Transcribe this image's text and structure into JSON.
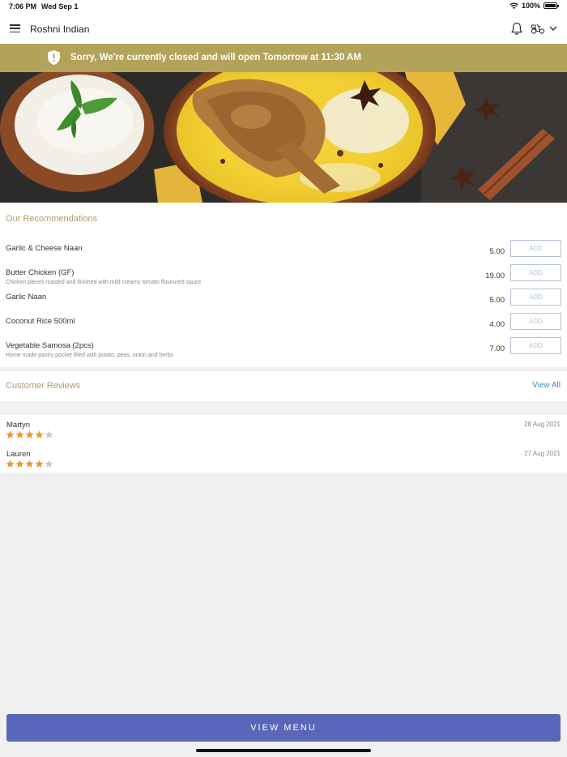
{
  "status_bar": {
    "time": "7:06 PM",
    "date": "Wed Sep 1",
    "battery": "100%"
  },
  "header": {
    "restaurant_name": "Roshni Indian"
  },
  "banner": {
    "message": "Sorry, We're currently closed and will open Tomorrow at 11:30 AM",
    "color": "#b3a35a"
  },
  "recommendations": {
    "title": "Our Recommendations",
    "items": [
      {
        "name": "Garlic & Cheese Naan",
        "description": "",
        "price": "5.00",
        "button": "ADD"
      },
      {
        "name": "Butter Chicken (GF)",
        "description": "Chicken pieces roasted and finished with mild creamy tomato flavoured sauce.",
        "price": "19.00",
        "button": "ADD"
      },
      {
        "name": "Garlic Naan",
        "description": "",
        "price": "5.00",
        "button": "ADD"
      },
      {
        "name": "Coconut Rice 500ml",
        "description": "",
        "price": "4.00",
        "button": "ADD"
      },
      {
        "name": "Vegetable Samosa (2pcs)",
        "description": "Home made pastry pocket filled with potato, peas, onion and herbs",
        "price": "7.00",
        "button": "ADD"
      }
    ]
  },
  "reviews": {
    "title": "Customer Reviews",
    "view_all": "View All",
    "items": [
      {
        "author": "Martyn",
        "date": "28 Aug 2021",
        "rating": 4,
        "max_rating": 5
      },
      {
        "author": "Lauren",
        "date": "27 Aug 2021",
        "rating": 4,
        "max_rating": 5
      }
    ]
  },
  "footer": {
    "button": "VIEW MENU",
    "color": "#5a66b9"
  },
  "icons": [
    "menu-icon",
    "bell-icon",
    "delivery-scooter-icon",
    "chevron-down-icon",
    "shield-alert-icon",
    "wifi-icon",
    "battery-icon",
    "star-icon"
  ]
}
